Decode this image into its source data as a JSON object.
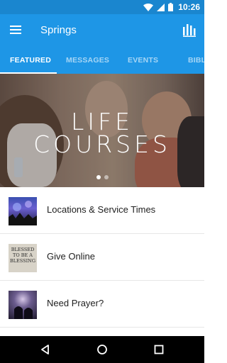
{
  "status": {
    "time": "10:26"
  },
  "app": {
    "title": "Springs"
  },
  "tabs": [
    {
      "label": "FEATURED",
      "active": true
    },
    {
      "label": "MESSAGES",
      "active": false
    },
    {
      "label": "EVENTS",
      "active": false
    },
    {
      "label": "BIBLE",
      "active": false
    }
  ],
  "hero": {
    "line1": "LIFE",
    "line2": "COURSES",
    "slide_count": 2,
    "current_slide": 1
  },
  "list": [
    {
      "label": "Locations & Service Times",
      "thumb_icon": "worship-photo"
    },
    {
      "label": "Give Online",
      "thumb_icon": "blessed-photo",
      "thumb_text": [
        "BLESSED",
        "TO BE A",
        "BLESSING"
      ]
    },
    {
      "label": "Need Prayer?",
      "thumb_icon": "prayer-photo"
    }
  ],
  "colors": {
    "status_bar": "#1a86cf",
    "app_bar": "#1e96e6",
    "nav_bar": "#000000"
  }
}
